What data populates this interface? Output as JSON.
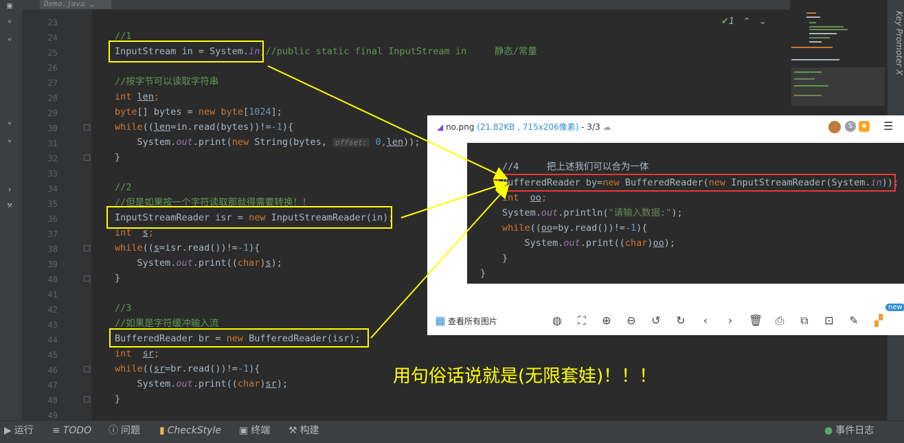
{
  "editor_tab": {
    "title": "Demo.java"
  },
  "line_numbers": [
    "23",
    "24",
    "25",
    "26",
    "27",
    "28",
    "29",
    "30",
    "31",
    "32",
    "33",
    "34",
    "35",
    "36",
    "37",
    "38",
    "39",
    "40",
    "41",
    "42",
    "43",
    "44",
    "45",
    "46",
    "47",
    "48",
    "49"
  ],
  "code": {
    "l24": "//1",
    "l25_a": "InputStream in = System.",
    "l25_b": "in",
    "l25_c": ";",
    "l25_d": "//public static final InputStream in     静态/常量",
    "l27": "//按字节可以读取字符串",
    "l28_kw": "int",
    "l28_v": "len",
    "l29_a": "byte",
    "l29_b": "[] bytes = ",
    "l29_c": "new",
    "l29_d": " byte",
    "l29_e": "[",
    "l29_f": "1024",
    "l29_g": "];",
    "l30_a": "while",
    "l30_b": "((",
    "l30_c": "len",
    "l30_d": "=in.read(bytes))!=",
    "l30_e": "-1",
    "l30_f": "){",
    "l31_a": "    System.",
    "l31_b": "out",
    "l31_c": ".print(",
    "l31_d": "new",
    "l31_e": " String(bytes, ",
    "l31_hint": "offset:",
    "l31_f": " 0",
    "l31_g": ",",
    "l31_h": "len",
    "l31_i": "));",
    "brace": "}",
    "l34": "//2",
    "l35": "//但是如果按一个字符读取那就得需要转换！！",
    "l36_a": "InputStreamReader isr = ",
    "l36_b": "new",
    "l36_c": " InputStreamReader(in);",
    "l37_kw": "int",
    "l37_v": "s",
    "l38_a": "while",
    "l38_b": "((",
    "l38_c": "s",
    "l38_d": "=isr.read())!=",
    "l38_e": "-1",
    "l38_f": "){",
    "l39_a": "    System.",
    "l39_b": "out",
    "l39_c": ".print((",
    "l39_d": "char",
    "l39_e": ")",
    "l39_f": "s",
    "l39_g": ");",
    "l42": "//3",
    "l43": "//如果是字符缓冲输入流",
    "l44_a": "BufferedReader br = ",
    "l44_b": "new",
    "l44_c": " BufferedReader(isr);",
    "l45_kw": "int",
    "l45_v": "sr",
    "l46_a": "while",
    "l46_b": "((",
    "l46_c": "sr",
    "l46_d": "=br.read())!=",
    "l46_e": "-1",
    "l46_f": "){",
    "l47_a": "    System.",
    "l47_b": "out",
    "l47_c": ".print((",
    "l47_d": "char",
    "l47_e": ")",
    "l47_f": "sr",
    "l47_g": ");"
  },
  "editor_status": {
    "check_count": "1"
  },
  "key_promoter": "Key Promoter X",
  "viewer": {
    "filename": "no.png",
    "meta": "(21.82KB , 715x206像素)",
    "index": " - 3/3",
    "view_all": "查看所有图片",
    "badge_new": "new",
    "code": {
      "c1": "//4     把上述我们可以合为一体",
      "c2_a": "BufferedReader by=",
      "c2_b": "new",
      "c2_c": " BufferedReader(",
      "c2_d": "new",
      "c2_e": " InputStreamReader(System.",
      "c2_f": "in",
      "c2_g": "));",
      "c3_kw": "int",
      "c3_v": "oo",
      "c3_end": ";",
      "c4_a": "System.",
      "c4_b": "out",
      "c4_c": ".println(",
      "c4_d": "\"请输入数据:\"",
      "c4_e": ");",
      "c5_a": "while",
      "c5_b": "((",
      "c5_c": "oo",
      "c5_d": "=by.read())!=",
      "c5_e": "-1",
      "c5_f": "){",
      "c6_a": "    System.",
      "c6_b": "out",
      "c6_c": ".print((",
      "c6_d": "char",
      "c6_e": ")",
      "c6_f": "oo",
      "c6_g": ");",
      "c7": "}",
      "c8": "}"
    }
  },
  "caption": "用句俗话说就是(无限套娃)！！！",
  "bottom_bar": {
    "run": "运行",
    "todo": "TODO",
    "problems": "问题",
    "checkstyle": "CheckStyle",
    "terminal": "终端",
    "build": "构建",
    "event_log": "事件日志"
  },
  "colors": {
    "annotation": "#ffff00",
    "highlight_red": "#e53935",
    "editor_bg": "#2b2b2b"
  }
}
